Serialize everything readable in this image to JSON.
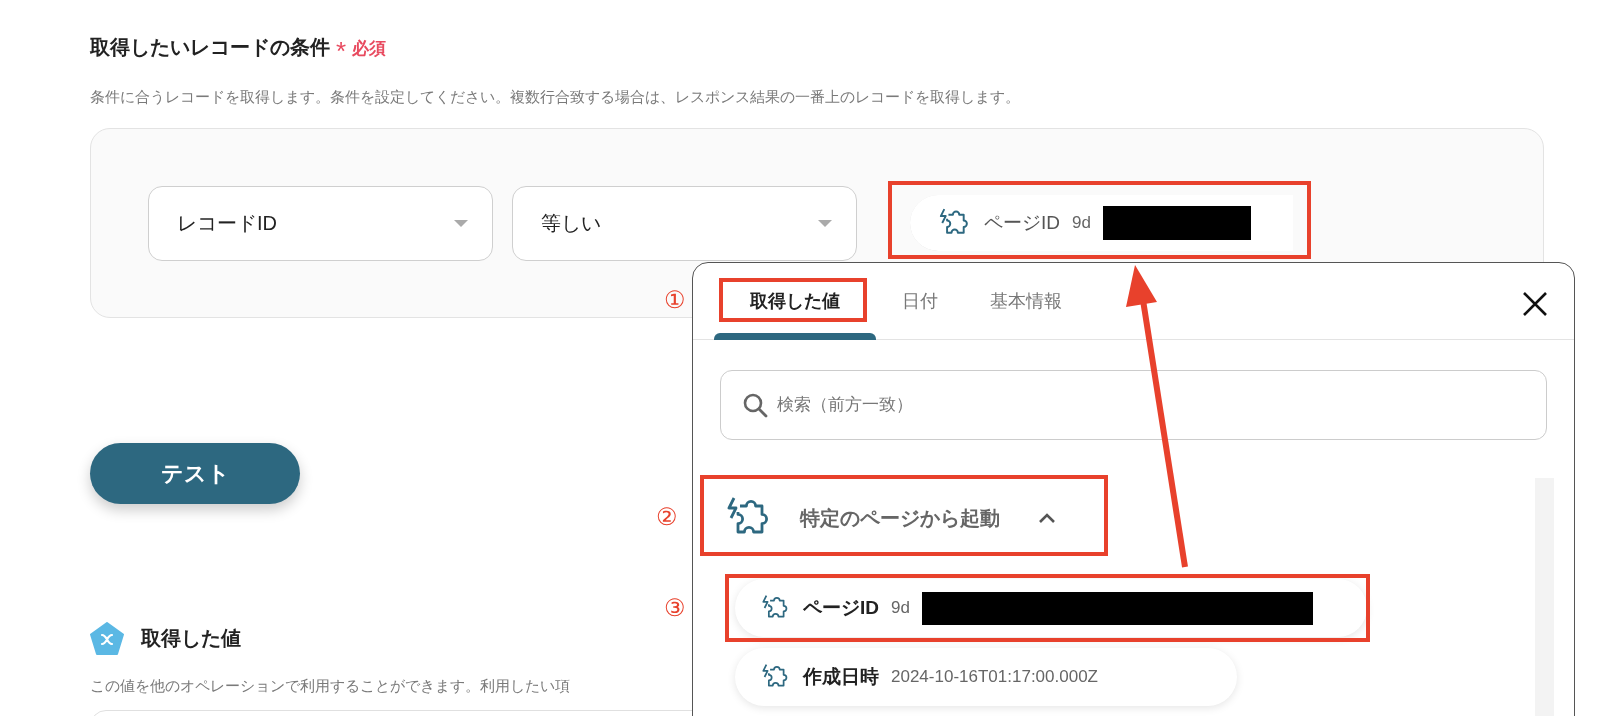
{
  "field": {
    "title": "取得したいレコードの条件",
    "required_mark": "*",
    "required_label": "必須",
    "description": "条件に合うレコードを取得します。条件を設定してください。複数行合致する場合は、レスポンス結果の一番上のレコードを取得します。"
  },
  "condition": {
    "field_select": {
      "value": "レコードID"
    },
    "operator_select": {
      "value": "等しい"
    },
    "value_chip": {
      "label": "ページID",
      "value": "9d",
      "redacted": true
    }
  },
  "test_button": {
    "label": "テスト"
  },
  "output": {
    "title": "取得した値",
    "description": "この値を他のオペレーションで利用することができます。利用したい項"
  },
  "picker": {
    "tabs": [
      {
        "label": "取得した値",
        "selected": true
      },
      {
        "label": "日付",
        "selected": false
      },
      {
        "label": "基本情報",
        "selected": false
      }
    ],
    "search": {
      "placeholder": "検索（前方一致）"
    },
    "group": {
      "label": "特定のページから起動",
      "expanded": true
    },
    "items": [
      {
        "label": "ページID",
        "value": "9d",
        "redacted": true
      },
      {
        "label": "作成日時",
        "value": "2024-10-16T01:17:00.000Z",
        "redacted": false
      }
    ]
  },
  "annotations": [
    "①",
    "②",
    "③"
  ]
}
